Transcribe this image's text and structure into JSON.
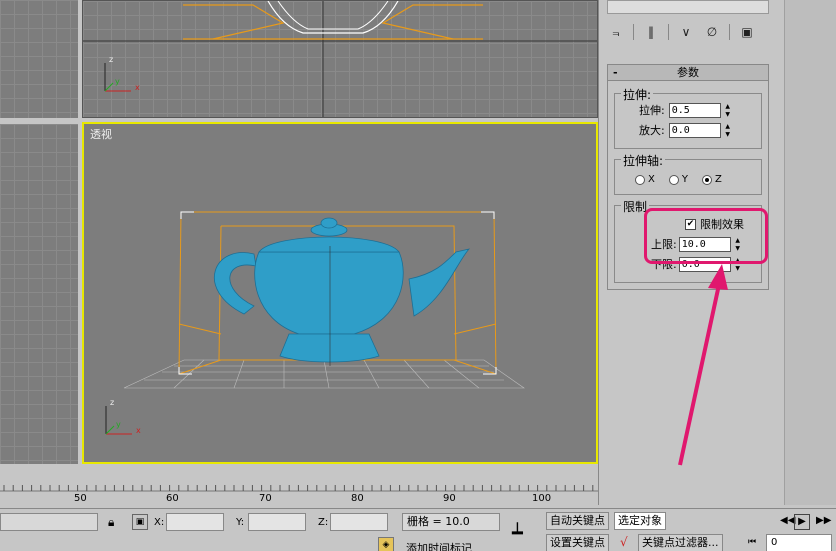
{
  "viewports": {
    "perspective_label": "透视",
    "axis_x": "x",
    "axis_y": "y",
    "axis_z": "z"
  },
  "panel": {
    "rollout_title": "参数",
    "rollout_toggle": "-",
    "stretch_group": {
      "title": "拉伸:",
      "stretch_label": "拉伸:",
      "stretch_value": "0.5",
      "amplify_label": "放大:",
      "amplify_value": "0.0"
    },
    "axis_group": {
      "title": "拉伸轴:",
      "options": [
        "X",
        "Y",
        "Z"
      ],
      "selected": "Z"
    },
    "limit_group": {
      "title": "限制",
      "limit_effect_label": "限制效果",
      "limit_effect_checked": true,
      "upper_label": "上限:",
      "upper_value": "10.0",
      "lower_label": "下限:",
      "lower_value": "0.0"
    },
    "highlight_color": "#e0186e"
  },
  "timeline": {
    "ticks": [
      "50",
      "60",
      "70",
      "80",
      "90",
      "100"
    ]
  },
  "status": {
    "x_label": "X:",
    "y_label": "Y:",
    "z_label": "Z:",
    "grid_text": "栅格 = 10.0",
    "auto_key": "自动关键点",
    "set_key": "设置关键点",
    "selected_option": "选定对象",
    "key_filters": "关键点过滤器...",
    "add_time_tag": "添加时间标记",
    "frame_value": "0"
  }
}
